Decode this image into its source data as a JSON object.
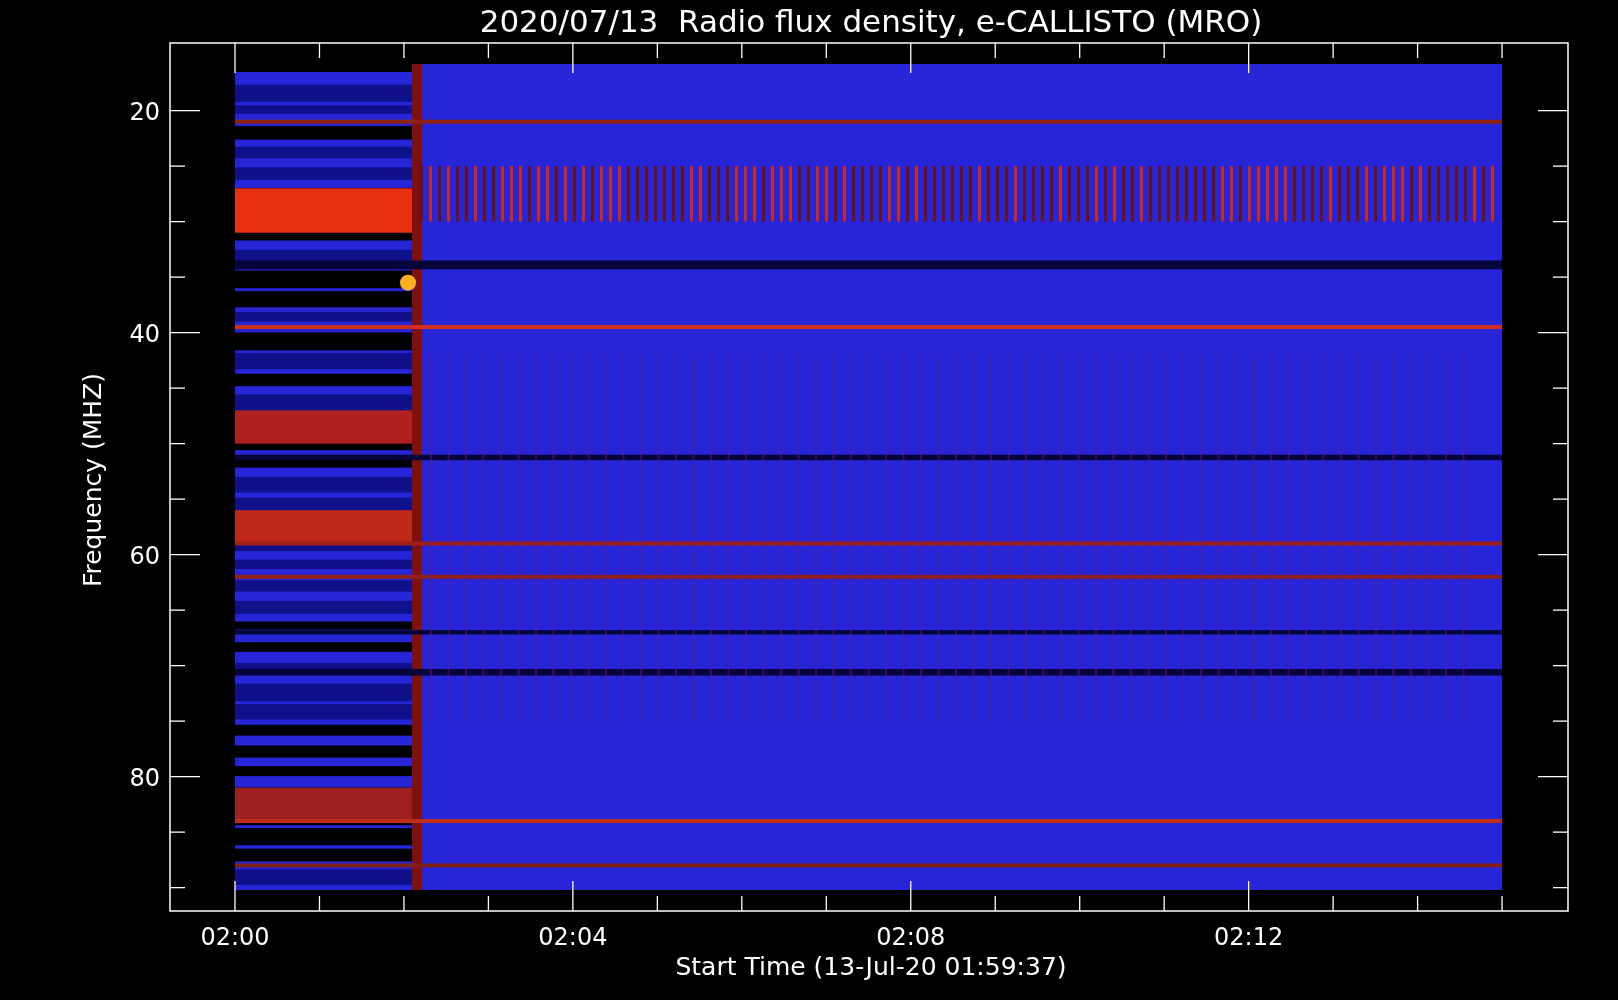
{
  "plot": {
    "title": "2020/07/13  Radio flux density, e-CALLISTO (MRO)",
    "ylabel": "Frequency (MHZ)",
    "xlabel": "Start Time (13-Jul-20 01:59:37)",
    "y_tick_labels": [
      "20",
      "40",
      "60",
      "80"
    ],
    "x_tick_labels": [
      "02:00",
      "02:04",
      "02:08",
      "02:12"
    ]
  }
}
